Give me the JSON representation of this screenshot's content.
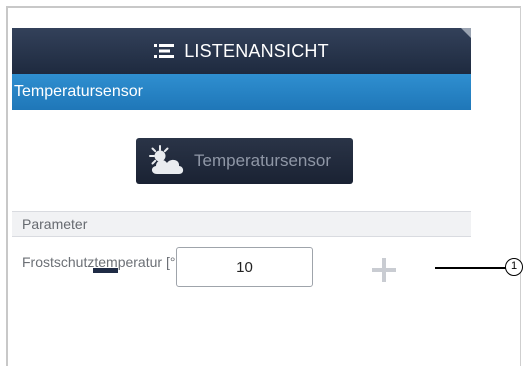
{
  "header": {
    "title": "LISTENANSICHT",
    "icon": "list-view-icon"
  },
  "title_bar": {
    "label": "Temperatursensor"
  },
  "device_button": {
    "label": "Temperatursensor",
    "icon": "weather-partly-cloudy-icon"
  },
  "section": {
    "label": "Parameter"
  },
  "parameter": {
    "label": "Frostschutztemperatur [°C]",
    "value": "10",
    "minus_icon": "minus-icon",
    "plus_icon": "plus-icon"
  },
  "callout": {
    "number": "1"
  },
  "colors": {
    "header_bg": "#1e2a3f",
    "title_bar_bg": "#1f77b8",
    "button_bg": "#1a2233",
    "minus_color": "#1f2b45",
    "plus_color": "#c9ccd2"
  }
}
